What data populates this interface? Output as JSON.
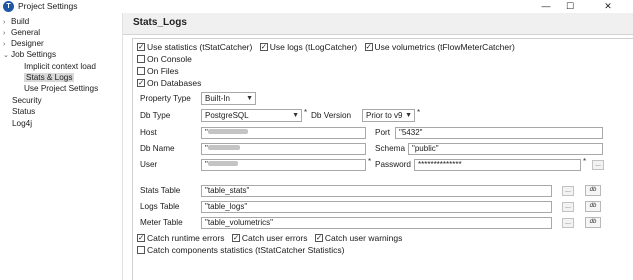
{
  "window": {
    "title": "Project Settings",
    "icon_letter": "T",
    "minimize": "—",
    "maximize": "☐",
    "close": "✕"
  },
  "tree": {
    "items": [
      {
        "label": "Build",
        "arrow": "›"
      },
      {
        "label": "General",
        "arrow": "›"
      },
      {
        "label": "Designer",
        "arrow": "›"
      },
      {
        "label": "Job Settings",
        "arrow": "⌄"
      },
      {
        "label": "Implicit context load"
      },
      {
        "label": "Stats & Logs"
      },
      {
        "label": "Use Project Settings"
      },
      {
        "label": "Security"
      },
      {
        "label": "Status"
      },
      {
        "label": "Log4j"
      }
    ]
  },
  "panel": {
    "title": "Stats_Logs"
  },
  "options": {
    "use_statistics": "Use statistics (tStatCatcher)",
    "use_logs": "Use logs (tLogCatcher)",
    "use_volumetrics": "Use volumetrics (tFlowMeterCatcher)",
    "on_console": "On Console",
    "on_files": "On Files",
    "on_databases": "On Databases"
  },
  "form": {
    "property_type_label": "Property Type",
    "property_type_value": "Built-In",
    "db_type_label": "Db Type",
    "db_type_value": "PostgreSQL",
    "db_version_label": "Db Version",
    "db_version_value": "Prior to v9",
    "host_label": "Host",
    "host_value": "\"",
    "port_label": "Port",
    "port_value": "\"5432\"",
    "db_name_label": "Db Name",
    "db_name_value": "\"",
    "schema_label": "Schema",
    "schema_value": "\"public\"",
    "user_label": "User",
    "user_value": "\"",
    "password_label": "Password",
    "password_value": "**************",
    "stats_table_label": "Stats Table",
    "stats_table_value": "\"table_stats\"",
    "logs_table_label": "Logs Table",
    "logs_table_value": "\"table_logs\"",
    "meter_table_label": "Meter Table",
    "meter_table_value": "\"table_volumetrics\"",
    "required_mark": "*",
    "ellipsis": "...",
    "db_button": "db"
  },
  "catch": {
    "runtime_errors": "Catch runtime errors",
    "user_errors": "Catch user errors",
    "user_warnings": "Catch user warnings",
    "components_statistics": "Catch components statistics (tStatCatcher Statistics)"
  }
}
